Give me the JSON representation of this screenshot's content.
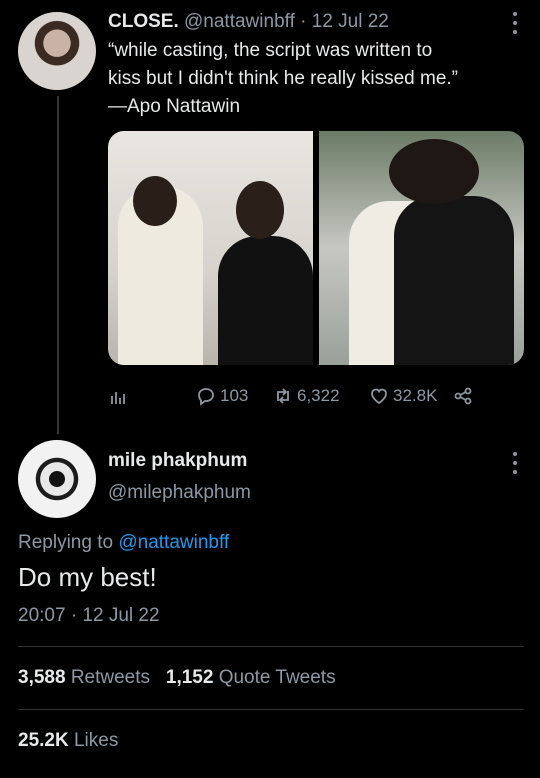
{
  "parent_tweet": {
    "name": "CLOSE.",
    "handle": "@nattawinbff",
    "separator": "·",
    "date": "12 Jul 22",
    "text_line1": "“while casting, the script was written to",
    "text_line2": "kiss but I didn't think he really kissed me.”",
    "text_line3": "—Apo Nattawin",
    "replies": "103",
    "retweets": "6,322",
    "likes": "32.8K"
  },
  "reply_tweet": {
    "name": "mile phakphum",
    "handle": "@milephakphum",
    "replying_prefix": "Replying to",
    "replying_to": "@nattawinbff",
    "text": "Do my best!",
    "timestamp": "20:07 · 12 Jul 22",
    "retweets_count": "3,588",
    "retweets_label": "Retweets",
    "quotes_count": "1,152",
    "quotes_label": "Quote Tweets",
    "likes_count": "25.2K",
    "likes_label": "Likes"
  },
  "colors": {
    "background": "#000000",
    "text": "#e7e9ea",
    "muted": "#8b98a5",
    "link": "#1d9bf0",
    "divider": "#2f3336"
  }
}
